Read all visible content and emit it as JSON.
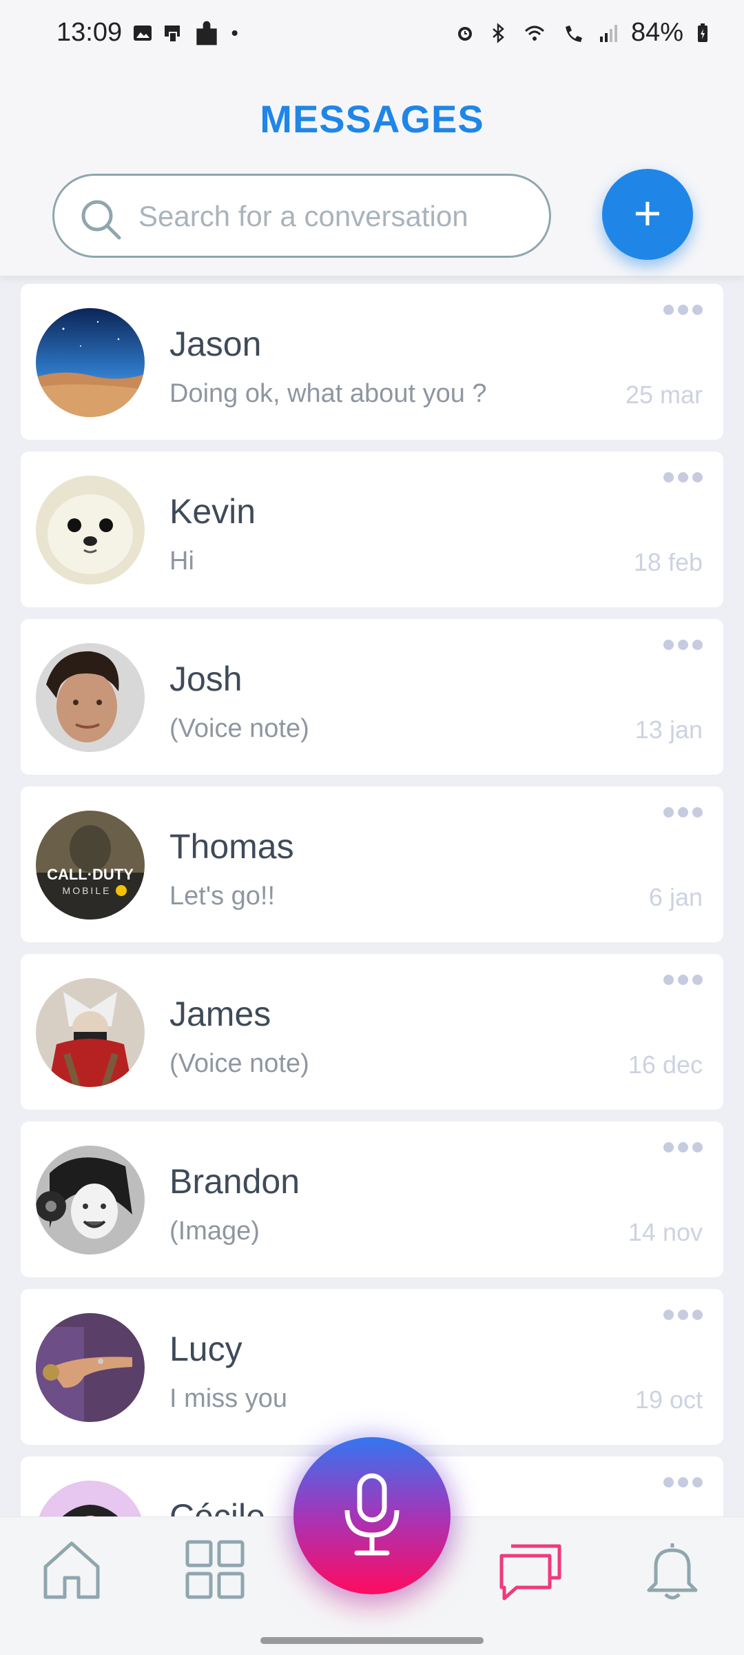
{
  "status_bar": {
    "time": "13:09",
    "battery": "84%"
  },
  "header": {
    "title": "MESSAGES",
    "search_placeholder": "Search for a conversation",
    "add_label": "+"
  },
  "conversations": [
    {
      "name": "Jason",
      "preview": "Doing ok, what about you ?",
      "date": "25 mar"
    },
    {
      "name": "Kevin",
      "preview": "Hi",
      "date": "18 feb"
    },
    {
      "name": "Josh",
      "preview": "(Voice note)",
      "date": "13 jan"
    },
    {
      "name": "Thomas",
      "preview": "Let's go!!",
      "date": "6 jan"
    },
    {
      "name": "James",
      "preview": "(Voice note)",
      "date": "16 dec"
    },
    {
      "name": "Brandon",
      "preview": "(Image)",
      "date": "14 nov"
    },
    {
      "name": "Lucy",
      "preview": "I miss you",
      "date": "19 oct"
    },
    {
      "name": "Cécile",
      "preview": "",
      "date": ""
    }
  ],
  "avatar_texts": {
    "thomas_line1": "CALL·DUTY",
    "thomas_line2": "MOBILE"
  },
  "colors": {
    "accent": "#1f86e8",
    "active_tab": "#ee3a7b",
    "mic_gradient_top": "#3476f0",
    "mic_gradient_bottom": "#ff0b5f"
  },
  "bottom_nav": {
    "items": [
      "home-icon",
      "grid-icon",
      "mic-icon",
      "chat-icon",
      "bell-icon"
    ],
    "active": "chat-icon"
  }
}
